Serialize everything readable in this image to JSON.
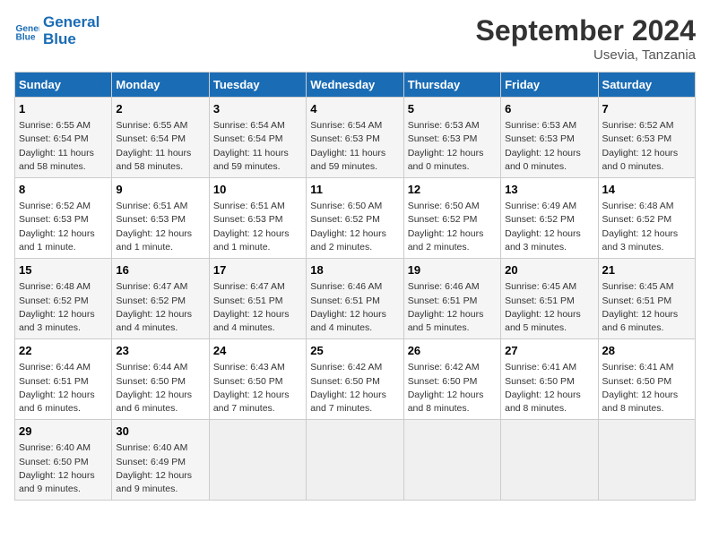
{
  "header": {
    "logo_line1": "General",
    "logo_line2": "Blue",
    "month": "September 2024",
    "location": "Usevia, Tanzania"
  },
  "days_of_week": [
    "Sunday",
    "Monday",
    "Tuesday",
    "Wednesday",
    "Thursday",
    "Friday",
    "Saturday"
  ],
  "weeks": [
    [
      {
        "day": "1",
        "info": "Sunrise: 6:55 AM\nSunset: 6:54 PM\nDaylight: 11 hours\nand 58 minutes."
      },
      {
        "day": "2",
        "info": "Sunrise: 6:55 AM\nSunset: 6:54 PM\nDaylight: 11 hours\nand 58 minutes."
      },
      {
        "day": "3",
        "info": "Sunrise: 6:54 AM\nSunset: 6:54 PM\nDaylight: 11 hours\nand 59 minutes."
      },
      {
        "day": "4",
        "info": "Sunrise: 6:54 AM\nSunset: 6:53 PM\nDaylight: 11 hours\nand 59 minutes."
      },
      {
        "day": "5",
        "info": "Sunrise: 6:53 AM\nSunset: 6:53 PM\nDaylight: 12 hours\nand 0 minutes."
      },
      {
        "day": "6",
        "info": "Sunrise: 6:53 AM\nSunset: 6:53 PM\nDaylight: 12 hours\nand 0 minutes."
      },
      {
        "day": "7",
        "info": "Sunrise: 6:52 AM\nSunset: 6:53 PM\nDaylight: 12 hours\nand 0 minutes."
      }
    ],
    [
      {
        "day": "8",
        "info": "Sunrise: 6:52 AM\nSunset: 6:53 PM\nDaylight: 12 hours\nand 1 minute."
      },
      {
        "day": "9",
        "info": "Sunrise: 6:51 AM\nSunset: 6:53 PM\nDaylight: 12 hours\nand 1 minute."
      },
      {
        "day": "10",
        "info": "Sunrise: 6:51 AM\nSunset: 6:53 PM\nDaylight: 12 hours\nand 1 minute."
      },
      {
        "day": "11",
        "info": "Sunrise: 6:50 AM\nSunset: 6:52 PM\nDaylight: 12 hours\nand 2 minutes."
      },
      {
        "day": "12",
        "info": "Sunrise: 6:50 AM\nSunset: 6:52 PM\nDaylight: 12 hours\nand 2 minutes."
      },
      {
        "day": "13",
        "info": "Sunrise: 6:49 AM\nSunset: 6:52 PM\nDaylight: 12 hours\nand 3 minutes."
      },
      {
        "day": "14",
        "info": "Sunrise: 6:48 AM\nSunset: 6:52 PM\nDaylight: 12 hours\nand 3 minutes."
      }
    ],
    [
      {
        "day": "15",
        "info": "Sunrise: 6:48 AM\nSunset: 6:52 PM\nDaylight: 12 hours\nand 3 minutes."
      },
      {
        "day": "16",
        "info": "Sunrise: 6:47 AM\nSunset: 6:52 PM\nDaylight: 12 hours\nand 4 minutes."
      },
      {
        "day": "17",
        "info": "Sunrise: 6:47 AM\nSunset: 6:51 PM\nDaylight: 12 hours\nand 4 minutes."
      },
      {
        "day": "18",
        "info": "Sunrise: 6:46 AM\nSunset: 6:51 PM\nDaylight: 12 hours\nand 4 minutes."
      },
      {
        "day": "19",
        "info": "Sunrise: 6:46 AM\nSunset: 6:51 PM\nDaylight: 12 hours\nand 5 minutes."
      },
      {
        "day": "20",
        "info": "Sunrise: 6:45 AM\nSunset: 6:51 PM\nDaylight: 12 hours\nand 5 minutes."
      },
      {
        "day": "21",
        "info": "Sunrise: 6:45 AM\nSunset: 6:51 PM\nDaylight: 12 hours\nand 6 minutes."
      }
    ],
    [
      {
        "day": "22",
        "info": "Sunrise: 6:44 AM\nSunset: 6:51 PM\nDaylight: 12 hours\nand 6 minutes."
      },
      {
        "day": "23",
        "info": "Sunrise: 6:44 AM\nSunset: 6:50 PM\nDaylight: 12 hours\nand 6 minutes."
      },
      {
        "day": "24",
        "info": "Sunrise: 6:43 AM\nSunset: 6:50 PM\nDaylight: 12 hours\nand 7 minutes."
      },
      {
        "day": "25",
        "info": "Sunrise: 6:42 AM\nSunset: 6:50 PM\nDaylight: 12 hours\nand 7 minutes."
      },
      {
        "day": "26",
        "info": "Sunrise: 6:42 AM\nSunset: 6:50 PM\nDaylight: 12 hours\nand 8 minutes."
      },
      {
        "day": "27",
        "info": "Sunrise: 6:41 AM\nSunset: 6:50 PM\nDaylight: 12 hours\nand 8 minutes."
      },
      {
        "day": "28",
        "info": "Sunrise: 6:41 AM\nSunset: 6:50 PM\nDaylight: 12 hours\nand 8 minutes."
      }
    ],
    [
      {
        "day": "29",
        "info": "Sunrise: 6:40 AM\nSunset: 6:50 PM\nDaylight: 12 hours\nand 9 minutes."
      },
      {
        "day": "30",
        "info": "Sunrise: 6:40 AM\nSunset: 6:49 PM\nDaylight: 12 hours\nand 9 minutes."
      },
      {
        "day": "",
        "info": ""
      },
      {
        "day": "",
        "info": ""
      },
      {
        "day": "",
        "info": ""
      },
      {
        "day": "",
        "info": ""
      },
      {
        "day": "",
        "info": ""
      }
    ]
  ]
}
